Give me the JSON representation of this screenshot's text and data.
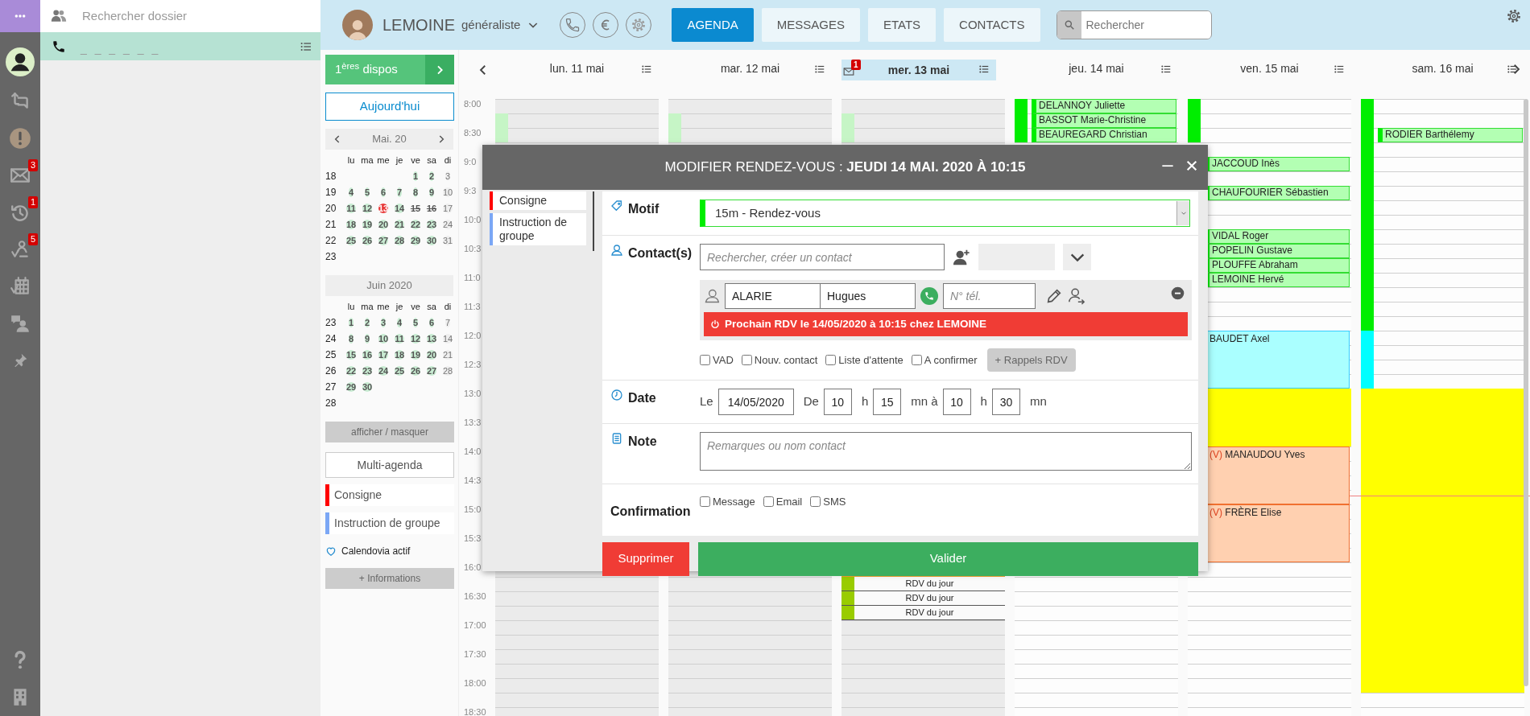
{
  "app_bar": {
    "items": [
      {
        "kind": "avatar"
      },
      {
        "kind": "repost"
      },
      {
        "kind": "alert"
      },
      {
        "kind": "mail",
        "badge": "3"
      },
      {
        "kind": "history",
        "badge": "1"
      },
      {
        "kind": "route",
        "badge": "5"
      },
      {
        "kind": "calendar"
      },
      {
        "kind": "chat"
      },
      {
        "kind": "pin"
      }
    ],
    "bottom_items": [
      {
        "kind": "help"
      },
      {
        "kind": "building"
      }
    ]
  },
  "folder_panel": {
    "search": {
      "placeholder": "Rechercher dossier"
    },
    "call_row": {
      "placeholder": "_ _ _ _ _ _"
    }
  },
  "header": {
    "doctor": {
      "name": "LEMOINE",
      "specialty": "généraliste"
    },
    "tabs": [
      {
        "label": "AGENDA",
        "selected": true
      },
      {
        "label": "MESSAGES",
        "selected": false
      },
      {
        "label": "ETATS",
        "selected": false
      },
      {
        "label": "CONTACTS",
        "selected": false
      }
    ],
    "search": {
      "placeholder": "Rechercher"
    }
  },
  "agenda_sidebar": {
    "first_available": "1$^{ères}$ dispos",
    "today_button": "Aujourd'hui",
    "months": [
      {
        "title": "Mai. 20",
        "navigable": true,
        "weekdays": [
          "lu",
          "ma",
          "me",
          "je",
          "ve",
          "sa",
          "di"
        ],
        "weeks": [
          {
            "week": "18",
            "days": [
              {
                "kind": "blank"
              },
              {
                "kind": "blank"
              },
              {
                "kind": "blank"
              },
              {
                "kind": "blank"
              },
              {
                "label": "1",
                "kind": "open"
              },
              {
                "label": "2",
                "kind": "open"
              },
              {
                "label": "3",
                "kind": "closed"
              }
            ]
          },
          {
            "week": "19",
            "days": [
              {
                "label": "4",
                "kind": "open"
              },
              {
                "label": "5",
                "kind": "open"
              },
              {
                "label": "6",
                "kind": "open"
              },
              {
                "label": "7",
                "kind": "open"
              },
              {
                "label": "8",
                "kind": "open"
              },
              {
                "label": "9",
                "kind": "open"
              },
              {
                "label": "10",
                "kind": "closed"
              }
            ]
          },
          {
            "week": "20",
            "days": [
              {
                "label": "11",
                "kind": "open"
              },
              {
                "label": "12",
                "kind": "open"
              },
              {
                "label": "13",
                "kind": "today"
              },
              {
                "label": "14",
                "kind": "open"
              },
              {
                "label": "15",
                "kind": "struck"
              },
              {
                "label": "16",
                "kind": "struck"
              },
              {
                "label": "17",
                "kind": "closed"
              }
            ]
          },
          {
            "week": "21",
            "days": [
              {
                "label": "18",
                "kind": "open"
              },
              {
                "label": "19",
                "kind": "open"
              },
              {
                "label": "20",
                "kind": "open"
              },
              {
                "label": "21",
                "kind": "open"
              },
              {
                "label": "22",
                "kind": "open"
              },
              {
                "label": "23",
                "kind": "open"
              },
              {
                "label": "24",
                "kind": "closed"
              }
            ]
          },
          {
            "week": "22",
            "days": [
              {
                "label": "25",
                "kind": "open"
              },
              {
                "label": "26",
                "kind": "open"
              },
              {
                "label": "27",
                "kind": "open"
              },
              {
                "label": "28",
                "kind": "open"
              },
              {
                "label": "29",
                "kind": "open"
              },
              {
                "label": "30",
                "kind": "open"
              },
              {
                "label": "31",
                "kind": "closed"
              }
            ]
          },
          {
            "week": "23"
          }
        ]
      },
      {
        "title": "Juin 2020",
        "navigable": false,
        "weekdays": [
          "lu",
          "ma",
          "me",
          "je",
          "ve",
          "sa",
          "di"
        ],
        "weeks": [
          {
            "week": "23",
            "days": [
              {
                "label": "1",
                "kind": "open"
              },
              {
                "label": "2",
                "kind": "open"
              },
              {
                "label": "3",
                "kind": "open"
              },
              {
                "label": "4",
                "kind": "open"
              },
              {
                "label": "5",
                "kind": "open"
              },
              {
                "label": "6",
                "kind": "open"
              },
              {
                "label": "7",
                "kind": "closed"
              }
            ]
          },
          {
            "week": "24",
            "days": [
              {
                "label": "8",
                "kind": "open"
              },
              {
                "label": "9",
                "kind": "open"
              },
              {
                "label": "10",
                "kind": "open"
              },
              {
                "label": "11",
                "kind": "open"
              },
              {
                "label": "12",
                "kind": "open"
              },
              {
                "label": "13",
                "kind": "open"
              },
              {
                "label": "14",
                "kind": "closed"
              }
            ]
          },
          {
            "week": "25",
            "days": [
              {
                "label": "15",
                "kind": "open"
              },
              {
                "label": "16",
                "kind": "open"
              },
              {
                "label": "17",
                "kind": "open"
              },
              {
                "label": "18",
                "kind": "open"
              },
              {
                "label": "19",
                "kind": "open"
              },
              {
                "label": "20",
                "kind": "open"
              },
              {
                "label": "21",
                "kind": "closed"
              }
            ]
          },
          {
            "week": "26",
            "days": [
              {
                "label": "22",
                "kind": "open"
              },
              {
                "label": "23",
                "kind": "open"
              },
              {
                "label": "24",
                "kind": "open"
              },
              {
                "label": "25",
                "kind": "open"
              },
              {
                "label": "26",
                "kind": "open"
              },
              {
                "label": "27",
                "kind": "open"
              },
              {
                "label": "28",
                "kind": "closed"
              }
            ]
          },
          {
            "week": "27",
            "days": [
              {
                "label": "29",
                "kind": "open"
              },
              {
                "label": "30",
                "kind": "open"
              }
            ]
          },
          {
            "week": "28"
          }
        ]
      }
    ],
    "toggle_button": "afficher / masquer",
    "multi_agenda_button": "Multi-agenda",
    "legend": [
      {
        "label": "Consigne",
        "color": "#ff0000"
      },
      {
        "label": "Instruction de groupe",
        "color": "#7ba7f5"
      }
    ],
    "status": "Calendovia actif",
    "info_button": "+ Informations"
  },
  "calendar": {
    "time_labels": [
      "8:00",
      "8:30",
      "9:0",
      "9:3",
      "10:0",
      "10:3",
      "11:0",
      "11:3",
      "12:0",
      "12:3",
      "13:0",
      "13:3",
      "14:0",
      "14:3",
      "15:0",
      "15:3",
      "16:0",
      "16:30",
      "17:00",
      "17:30",
      "18:00",
      "18:30"
    ],
    "days": [
      {
        "label": "lun. 11 mai",
        "selected": false,
        "shaded": true,
        "rows": [
          {},
          {
            "band": {
              "color": "#c6f5c6"
            }
          },
          {
            "band": {
              "color": "#c6f5c6"
            }
          }
        ]
      },
      {
        "label": "mar. 12 mai",
        "selected": false,
        "shaded": true,
        "rows": [
          {},
          {
            "band": {
              "color": "#c6f5c6"
            }
          },
          {
            "band": {
              "color": "#c6f5c6"
            }
          }
        ]
      },
      {
        "label": "mer. 13 mai",
        "selected": true,
        "shaded": true,
        "badge": "1",
        "rows": [
          {},
          {
            "band": {
              "color": "#c6f5c6"
            }
          },
          {
            "band": {
              "color": "#c6f5c6"
            }
          },
          {},
          {},
          {},
          {},
          {},
          {},
          {},
          {},
          {},
          {},
          {},
          {},
          {},
          {},
          {},
          {},
          {},
          {},
          {},
          {},
          {},
          {},
          {},
          {},
          {},
          {},
          {},
          {},
          {},
          {
            "fill": {
              "color": "#f0a030"
            }
          },
          {
            "item": {
              "kind": "day_rdv",
              "name": "RDV du jour",
              "color": "#99cc00"
            }
          },
          {
            "item": {
              "kind": "day_rdv",
              "name": "RDV du jour",
              "color": "#99cc00"
            }
          },
          {
            "item": {
              "kind": "day_rdv",
              "name": "RDV du jour",
              "color": "#99cc00"
            }
          }
        ]
      },
      {
        "label": "jeu. 14 mai",
        "selected": false,
        "shaded": false,
        "rows": [
          {
            "band": {
              "color": "#00ee00"
            },
            "item": {
              "kind": "rdv",
              "name": "DELANNOY Juliette",
              "color": "#b3ffb3"
            }
          },
          {
            "band": {
              "color": "#00ee00"
            },
            "item": {
              "kind": "rdv",
              "name": "BASSOT Marie-Christine",
              "color": "#b3ffb3"
            }
          },
          {
            "band": {
              "color": "#00ee00"
            },
            "item": {
              "kind": "rdv",
              "name": "BEAUREGARD Christian",
              "color": "#b3ffb3"
            }
          }
        ]
      },
      {
        "label": "ven. 15 mai",
        "selected": false,
        "shaded": false,
        "rows": [
          {
            "band": {
              "color": "#00ee00"
            }
          },
          {
            "band": {
              "color": "#00ee00"
            }
          },
          {
            "band": {
              "color": "#00ee00"
            }
          },
          {},
          {
            "item": {
              "kind": "rdv",
              "name": "JACCOUD Inès",
              "color": "#b3ffb3"
            }
          },
          {},
          {
            "item": {
              "kind": "rdv",
              "name": "CHAUFOURIER Sébastien",
              "color": "#b3ffb3"
            }
          },
          {},
          {},
          {
            "item": {
              "kind": "rdv",
              "name": "VIDAL Roger",
              "color": "#b3ffb3"
            }
          },
          {
            "item": {
              "kind": "rdv",
              "name": "POPELIN Gustave",
              "color": "#b3ffb3"
            }
          },
          {
            "item": {
              "kind": "rdv",
              "name": "PLOUFFE Abraham",
              "color": "#b3ffb3"
            }
          },
          {
            "item": {
              "kind": "rdv",
              "name": "LEMOINE Hervé",
              "color": "#b3ffb3"
            }
          },
          {},
          {},
          {},
          {
            "item": {
              "kind": "priority",
              "name": "BAUDET Axel",
              "color": "#aaffff"
            }
          },
          {
            "continued": true
          },
          {
            "continued": true
          },
          {
            "continued": true
          },
          {
            "fill": {
              "color": "#ffff00"
            }
          },
          {
            "fill": {
              "color": "#ffff00"
            }
          },
          {
            "fill": {
              "color": "#ffff00"
            }
          },
          {
            "fill": {
              "color": "#ffff00"
            }
          },
          {
            "item": {
              "kind": "visit",
              "prefix": "(V)",
              "name": "MANAUDOU Yves",
              "color": "#ffd0b0"
            }
          },
          {
            "continued": true
          },
          {
            "continued": true
          },
          {
            "continued": true
          },
          {
            "item": {
              "kind": "visit",
              "prefix": "(V)",
              "name": "FRÈRE Elise",
              "color": "#ffd0b0"
            }
          },
          {
            "continued": true
          },
          {
            "continued": true
          },
          {
            "continued": true
          }
        ]
      },
      {
        "label": "sam. 16 mai",
        "selected": false,
        "shaded": false,
        "rows": [
          {
            "band": {
              "color": "#00ee00"
            }
          },
          {
            "band": {
              "color": "#00ee00"
            }
          },
          {
            "band": {
              "color": "#00ee00"
            },
            "item": {
              "kind": "rdv",
              "name": "RODIER Barthélemy",
              "color": "#b3ffb3"
            }
          },
          {
            "band": {
              "color": "#00ee00"
            }
          },
          {
            "band": {
              "color": "#00ee00"
            }
          },
          {
            "band": {
              "color": "#00ee00"
            }
          },
          {
            "band": {
              "color": "#00ee00"
            }
          },
          {
            "band": {
              "color": "#00ee00"
            }
          },
          {
            "band": {
              "color": "#00ee00"
            }
          },
          {
            "band": {
              "color": "#00ee00"
            }
          },
          {
            "band": {
              "color": "#00ee00"
            }
          },
          {
            "band": {
              "color": "#00ee00"
            }
          },
          {
            "band": {
              "color": "#00ee00"
            }
          },
          {
            "band": {
              "color": "#00ee00"
            }
          },
          {
            "band": {
              "color": "#00ee00"
            }
          },
          {
            "band": {
              "color": "#00ee00"
            }
          },
          {
            "band": {
              "color": "#00ffff"
            }
          },
          {
            "band": {
              "color": "#00ffff"
            }
          },
          {
            "band": {
              "color": "#00ffff"
            }
          },
          {
            "band": {
              "color": "#00ffff"
            }
          },
          {
            "fill": {
              "color": "#ffff00"
            }
          },
          {
            "fill": {
              "color": "#ffff00"
            }
          },
          {
            "fill": {
              "color": "#ffff00"
            }
          },
          {
            "fill": {
              "color": "#ffff00"
            }
          },
          {
            "fill": {
              "color": "#ffff00"
            }
          },
          {
            "fill": {
              "color": "#ffff00"
            }
          },
          {
            "fill": {
              "color": "#ffff00"
            }
          },
          {
            "fill": {
              "color": "#ffff00"
            },
            "now": true
          },
          {
            "fill": {
              "color": "#ffff00"
            }
          },
          {
            "fill": {
              "color": "#ffff00"
            }
          },
          {
            "fill": {
              "color": "#ffff00"
            }
          },
          {
            "fill": {
              "color": "#ffff00"
            }
          },
          {
            "fill": {
              "color": "#ffff00"
            }
          },
          {
            "fill": {
              "color": "#ffff00"
            }
          },
          {
            "fill": {
              "color": "#ffff00"
            }
          },
          {
            "fill": {
              "color": "#ffff00"
            }
          },
          {
            "fill": {
              "color": "#ffff00"
            }
          },
          {
            "fill": {
              "color": "#ffff00"
            }
          },
          {
            "fill": {
              "color": "#ffff00"
            }
          },
          {
            "fill": {
              "color": "#ffff00"
            }
          },
          {
            "fill": {
              "color": "#ffff00"
            }
          }
        ]
      }
    ]
  },
  "modal": {
    "title": "MODIFIER RENDEZ-VOUS : **JEUDI 14 MAI. 2020 À 10:15**",
    "side_tabs": [
      {
        "label": "Consigne",
        "color": "#ff0000"
      },
      {
        "label": "Instruction de groupe",
        "color": "#7ba7f5"
      }
    ],
    "motif": {
      "label": "Motif",
      "value": "15m - Rendez-vous"
    },
    "contacts": {
      "label": "Contact(s)",
      "search": {
        "placeholder": "Rechercher, créer un contact"
      },
      "contact": {
        "last_name": "ALARIE",
        "first_name": "Hugues",
        "phone": {
          "placeholder": "N° tél."
        },
        "next_appointment": "Prochain RDV le 14/05/2020 à 10:15 chez LEMOINE"
      },
      "options": [
        {
          "label": "VAD",
          "checked": false
        },
        {
          "label": "Nouv. contact",
          "checked": false
        },
        {
          "label": "Liste d'attente",
          "checked": false
        },
        {
          "label": "A confirmer",
          "checked": false
        }
      ],
      "reminders_button": "+ Rappels RDV"
    },
    "date": {
      "label": "Date",
      "parts": [
        {
          "kind": "text",
          "text": "Le"
        },
        {
          "kind": "input",
          "value": "14/05/2020"
        },
        {
          "kind": "text",
          "text": "De"
        },
        {
          "kind": "input",
          "value": "10"
        },
        {
          "kind": "text",
          "text": "h"
        },
        {
          "kind": "input",
          "value": "15"
        },
        {
          "kind": "text",
          "text": "mn à"
        },
        {
          "kind": "input",
          "value": "10"
        },
        {
          "kind": "text",
          "text": "h"
        },
        {
          "kind": "input",
          "value": "30"
        },
        {
          "kind": "text",
          "text": "mn"
        }
      ]
    },
    "note": {
      "label": "Note",
      "placeholder": "Remarques ou nom contact"
    },
    "confirmation": {
      "label": "Confirmation",
      "options": [
        {
          "label": "Message",
          "checked": false
        },
        {
          "label": "Email",
          "checked": false
        },
        {
          "label": "SMS",
          "checked": false
        }
      ]
    },
    "buttons": [
      {
        "label": "Supprimer",
        "kind": "danger"
      },
      {
        "label": "Valider",
        "kind": "primary"
      }
    ]
  }
}
